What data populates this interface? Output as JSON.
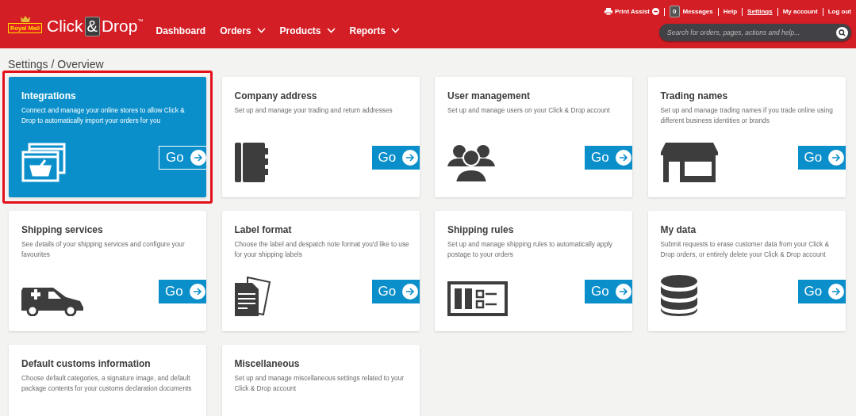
{
  "header": {
    "logo": {
      "badge": "Royal Mail",
      "word_before": "Click",
      "ampersand": "&",
      "word_after": "Drop",
      "trademark": "™"
    },
    "nav": [
      {
        "label": "Dashboard",
        "dropdown": false
      },
      {
        "label": "Orders",
        "dropdown": true
      },
      {
        "label": "Products",
        "dropdown": true
      },
      {
        "label": "Reports",
        "dropdown": true
      }
    ],
    "top_links": [
      {
        "kind": "print",
        "label": "Print Assist",
        "selected": false
      },
      {
        "kind": "messages",
        "label": "Messages",
        "count": "0",
        "selected": false
      },
      {
        "kind": "link",
        "label": "Help",
        "selected": false
      },
      {
        "kind": "link",
        "label": "Settings",
        "selected": true
      },
      {
        "kind": "link",
        "label": "My account",
        "selected": false
      },
      {
        "kind": "link",
        "label": "Log out",
        "selected": false
      }
    ],
    "search": {
      "placeholder": "Search for orders, pages, actions and help..."
    }
  },
  "breadcrumb": "Settings / Overview",
  "cards": [
    {
      "title": "Integrations",
      "description": "Connect and manage your online stores to allow Click & Drop to automatically import your orders for you",
      "kind": "integrations",
      "button": "Go",
      "selected": true,
      "highlighted": true
    },
    {
      "title": "Company address",
      "description": "Set up and manage your trading and return addresses",
      "kind": "notebook",
      "button": "Go",
      "selected": false,
      "highlighted": false
    },
    {
      "title": "User management",
      "description": "Set up and manage users on your Click & Drop account",
      "kind": "users",
      "button": "Go",
      "selected": false,
      "highlighted": false
    },
    {
      "title": "Trading names",
      "description": "Set up and manage trading names if you trade online using different business identities or brands",
      "kind": "shop",
      "button": "Go",
      "selected": false,
      "highlighted": false
    },
    {
      "title": "Shipping services",
      "description": "See details of your shipping services and configure your favourites",
      "kind": "van",
      "button": "Go",
      "selected": false,
      "highlighted": false
    },
    {
      "title": "Label format",
      "description": "Choose the label and despatch note format you'd like to use for your shipping labels",
      "kind": "documents",
      "button": "Go",
      "selected": false,
      "highlighted": false
    },
    {
      "title": "Shipping rules",
      "description": "Set up and manage shipping rules to automatically apply postage to your orders",
      "kind": "rules",
      "button": "Go",
      "selected": false,
      "highlighted": false
    },
    {
      "title": "My data",
      "description": "Submit requests to erase customer data from your Click & Drop orders, or entirely delete your Click & Drop account",
      "kind": "database",
      "button": "Go",
      "selected": false,
      "highlighted": false
    },
    {
      "title": "Default customs information",
      "description": "Choose default categories, a signature image, and default package contents for your customs declaration documents",
      "selected": false,
      "highlighted": false
    },
    {
      "title": "Miscellaneous",
      "description": "Set up and manage miscellaneous settings related to your Click & Drop account",
      "selected": false,
      "highlighted": false
    }
  ]
}
